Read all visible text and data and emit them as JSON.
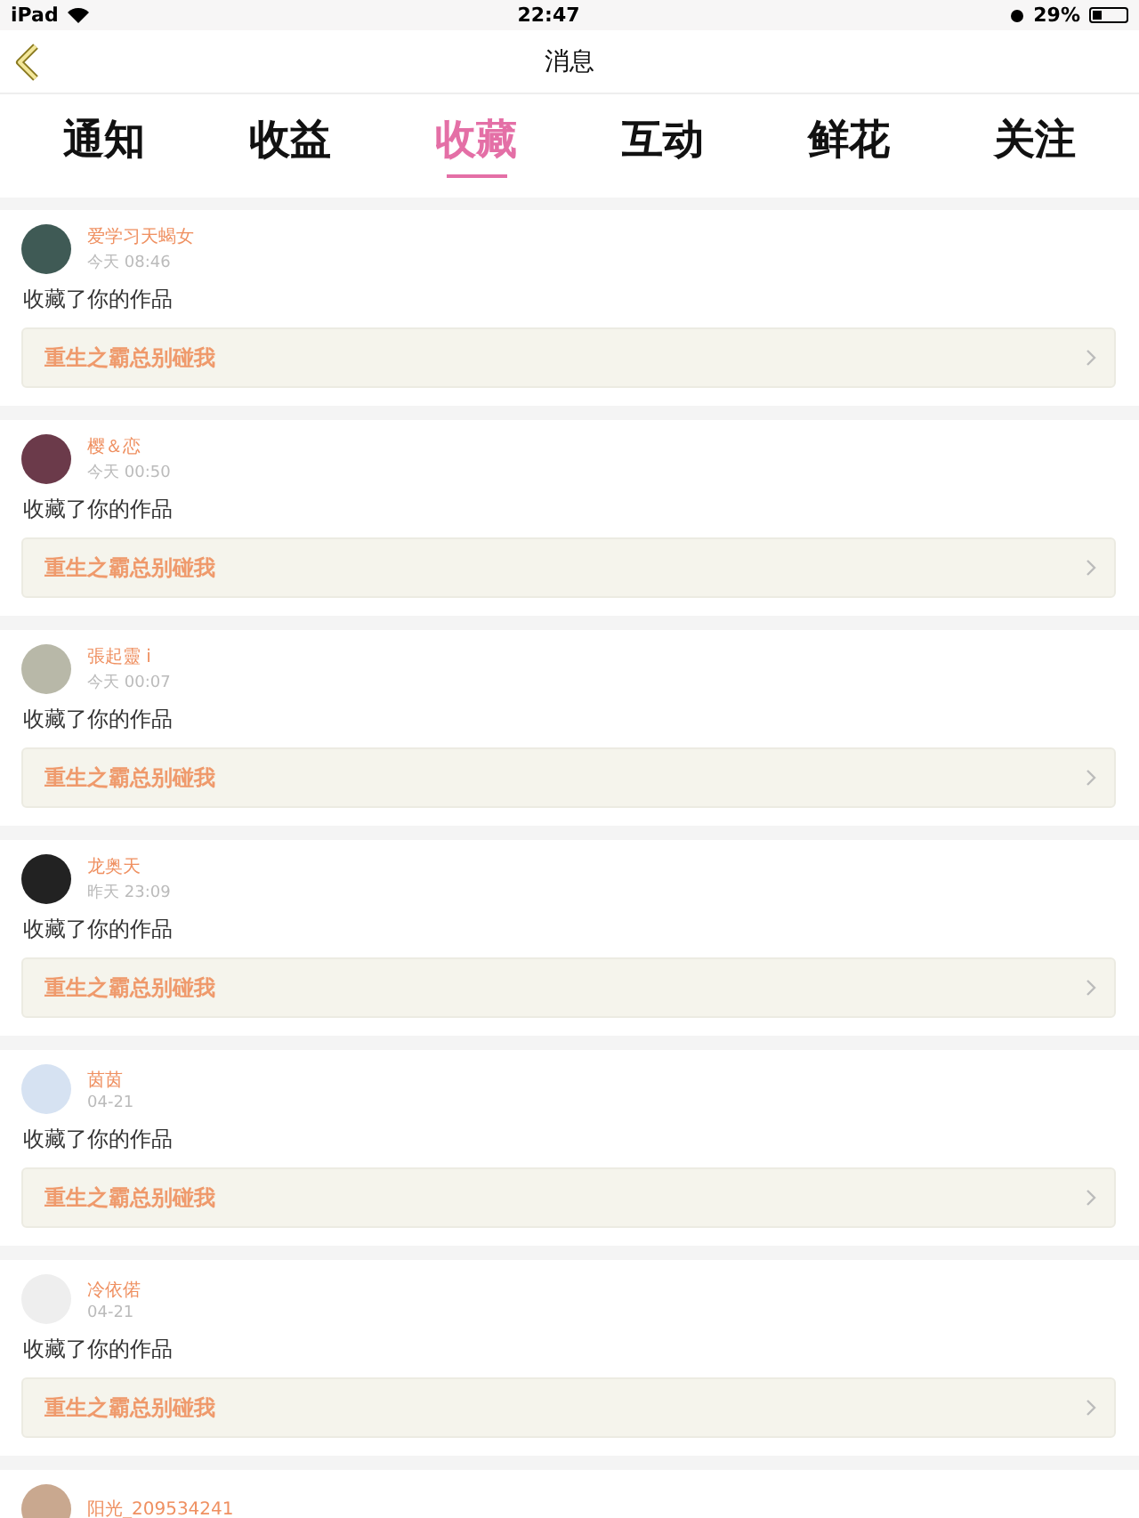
{
  "status_bar": {
    "device": "iPad",
    "time": "22:47",
    "battery": "29%"
  },
  "nav": {
    "title": "消息"
  },
  "tabs": [
    {
      "label": "通知",
      "selected": false
    },
    {
      "label": "收益",
      "selected": false
    },
    {
      "label": "收藏",
      "selected": true
    },
    {
      "label": "互动",
      "selected": false
    },
    {
      "label": "鲜花",
      "selected": false
    },
    {
      "label": "关注",
      "selected": false
    }
  ],
  "messages": [
    {
      "name": "爱学习天蝎女",
      "time": "今天 08:46",
      "text": "收藏了你的作品",
      "work": "重生之霸总别碰我"
    },
    {
      "name": "樱＆恋",
      "time": "今天 00:50",
      "text": "收藏了你的作品",
      "work": "重生之霸总别碰我"
    },
    {
      "name": "張起靈 i",
      "time": "今天 00:07",
      "text": "收藏了你的作品",
      "work": "重生之霸总别碰我"
    },
    {
      "name": "龙奥天",
      "time": "昨天 23:09",
      "text": "收藏了你的作品",
      "work": "重生之霸总别碰我"
    },
    {
      "name": "茵茵",
      "time": "04-21",
      "text": "收藏了你的作品",
      "work": "重生之霸总别碰我"
    },
    {
      "name": "冷依偌",
      "time": "04-21",
      "text": "收藏了你的作品",
      "work": "重生之霸总别碰我"
    },
    {
      "name": "阳光_209534241"
    }
  ]
}
